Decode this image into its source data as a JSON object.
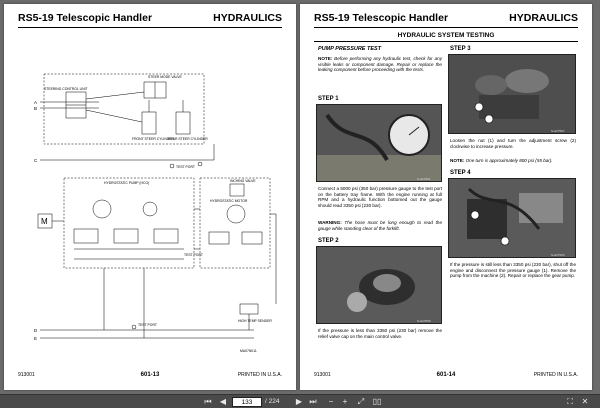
{
  "left_page": {
    "title": "RS5-19 Telescopic Handler",
    "section": "HYDRAULICS",
    "footer_left": "913001",
    "footer_page": "601-13",
    "footer_right": "PRINTED IN U.S.A.",
    "drawing_id": "MA07N011",
    "labels": {
      "steering_control_unit": "STEERING CONTROL UNIT",
      "steer_mode_valve": "STEER MODE VALVE",
      "front_steer_cylinder": "FRONT STEER CYLINDER",
      "rear_steer_cylinder": "REAR STEER CYLINDER",
      "test_port_1": "TEST PORT",
      "hydrostatic_pump": "HYDROSTATIC PUMP (HCO)",
      "inching_valve": "INCHING VALVE",
      "hydrostatic_motor": "HYDROSTATIC MOTOR",
      "test_port_2": "TEST PORT",
      "test_port_3": "TEST PORT",
      "high_temp_sender": "HIGH TEMP SENDER",
      "motor": "M",
      "port_a": "A",
      "port_b": "B",
      "port_c": "C",
      "port_d": "D",
      "port_e": "E"
    }
  },
  "right_page": {
    "title": "RS5-19 Telescopic Handler",
    "section": "HYDRAULICS",
    "banner": "HYDRAULIC SYSTEM TESTING",
    "subtitle": "PUMP PRESSURE TEST",
    "note_label": "NOTE:",
    "note_text": "Before performing any hydraulic test, check for any visible leaks or component damage. Repair or replace the leaking component before proceeding with the tests.",
    "step1": "STEP 1",
    "step1_text": "Connect a 5000 psi (350 bar) pressure gauge to the test port on the battery tray frame. With the engine running at full RPM and a hydraulic function bottomed out the gauge should read 3350 psi (230 bar).",
    "warning_label": "WARNING:",
    "warning_text": "The hose must be long enough to read the gauge while standing clear of the forklift.",
    "step2": "STEP 2",
    "step2_text": "If the pressure is less than 3350 psi (230 bar) remove the relief valve cap on the main control valve.",
    "step3": "STEP 3",
    "step3_text": "Loosen the nut (1) and turn the adjustment screw (2) clockwise to increase pressure.",
    "note2_label": "NOTE:",
    "note2_text": "One turn is approximately 800 psi (55 bar).",
    "step4": "STEP 4",
    "step4_text": "If the pressure is still less than 3350 psi (230 bar), shut off the engine and disconnect the pressure gauge (1). Remove the pump from the machine (2). Repair or replace the gear pump.",
    "photo_ids": [
      "S-H27601",
      "S-H27599",
      "S-H27597",
      "S-H27603"
    ],
    "footer_left": "913001",
    "footer_page": "601-14",
    "footer_right": "PRINTED IN U.S.A."
  },
  "toolbar": {
    "current_page": "133",
    "total_pages": "/ 224"
  }
}
